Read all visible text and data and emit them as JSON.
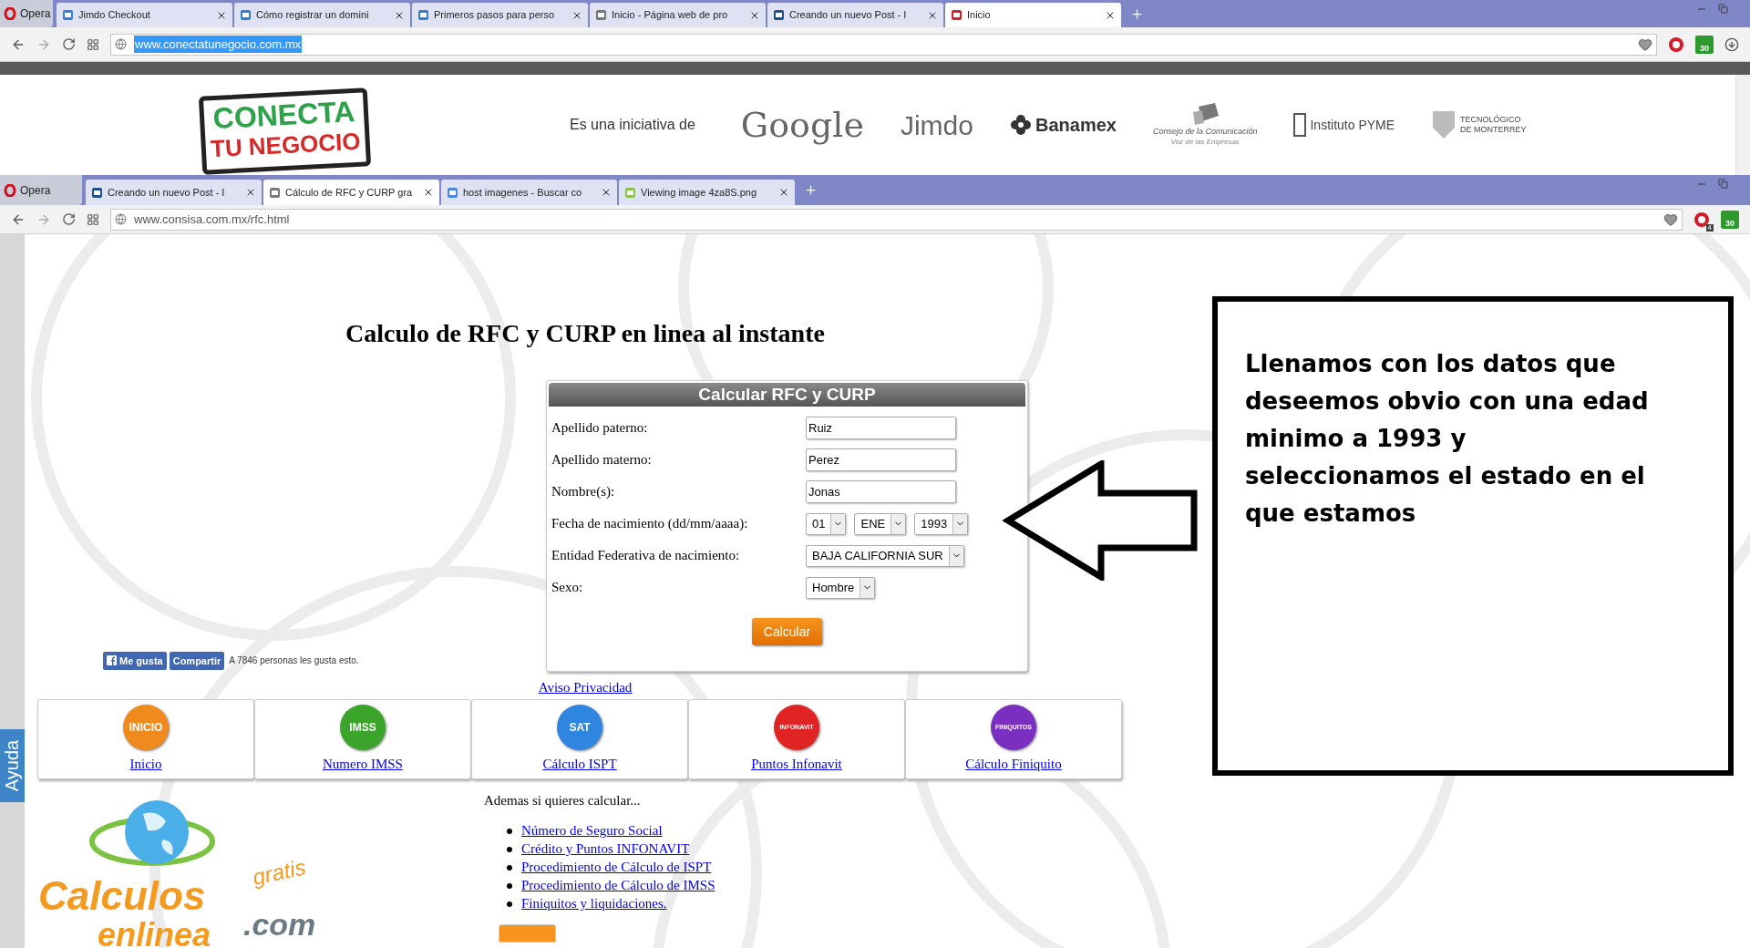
{
  "back_window": {
    "menu_button": "Opera",
    "tabs": [
      {
        "label": "Jimdo Checkout",
        "selected": false,
        "color": "#2f7fd6"
      },
      {
        "label": "Cómo registrar un domini",
        "selected": false,
        "color": "#2f7fd6"
      },
      {
        "label": "Primeros pasos para perso",
        "selected": false,
        "color": "#2f7fd6"
      },
      {
        "label": "Inicio - Página web de pro",
        "selected": false,
        "color": "#777777"
      },
      {
        "label": "Creando un nuevo Post - I",
        "selected": false,
        "color": "#1d4f8c"
      },
      {
        "label": "Inicio",
        "selected": true,
        "color": "#d81e2c"
      }
    ],
    "address": {
      "value": "www.conectatunegocio.com.mx",
      "highlighted": true
    },
    "extension_badge": "30",
    "header": {
      "logo": [
        "CONECTA",
        "TU NEGOCIO"
      ],
      "tagline": "Es una iniciativa de",
      "partners": [
        {
          "kind": "google",
          "name": "Google"
        },
        {
          "kind": "jimdo",
          "name": "Jimdo"
        },
        {
          "kind": "banamex",
          "name": "Banamex"
        },
        {
          "kind": "consejo",
          "name": "Consejo de la Comunicación",
          "sub": "Voz de las Empresas"
        },
        {
          "kind": "pyme",
          "name": "Instituto PYME"
        },
        {
          "kind": "tec",
          "name": "TECNOLÓGICO DE MONTERREY"
        }
      ]
    }
  },
  "front_window": {
    "menu_button": "Opera",
    "tabs": [
      {
        "label": "Creando un nuevo Post - I",
        "selected": false,
        "color": "#1d4f8c"
      },
      {
        "label": "Cálculo de RFC y CURP gra",
        "selected": true,
        "color": "#777777"
      },
      {
        "label": "host imagenes - Buscar co",
        "selected": false,
        "color": "#4a86e8"
      },
      {
        "label": "Viewing image 4za8S.png",
        "selected": false,
        "color": "#8bc34a"
      }
    ],
    "address": {
      "value": "www.consisa.com.mx/rfc.html",
      "highlighted": false
    },
    "notification_badge": "4",
    "extension_badge": "30"
  },
  "page": {
    "title": "Calculo de RFC y CURP en linea al instante",
    "form": {
      "title": "Calcular RFC y CURP",
      "fields": [
        {
          "kind": "text",
          "label": "Apellido paterno:",
          "value": "Ruiz"
        },
        {
          "kind": "text",
          "label": "Apellido materno:",
          "value": "Perez"
        },
        {
          "kind": "text",
          "label": "Nombre(s):",
          "value": "Jonas"
        },
        {
          "kind": "select",
          "label": "Fecha de nacimiento (dd/mm/aaaa):",
          "options": [
            "01",
            "ENE",
            "1993"
          ]
        },
        {
          "kind": "select",
          "label": "Entidad Federativa de nacimiento:",
          "options": [
            "BAJA CALIFORNIA SUR"
          ]
        },
        {
          "kind": "select",
          "label": "Sexo:",
          "options": [
            "Hombre"
          ]
        }
      ],
      "button": "Calcular"
    },
    "social": {
      "like": "Me gusta",
      "share": "Compartir",
      "count": "A 7846 personas les gusta esto."
    },
    "privacy_link": "Aviso Privacidad",
    "cards": [
      {
        "badge": "INICIO",
        "label": "Inicio",
        "color": "#f08a1c"
      },
      {
        "badge": "IMSS",
        "label": "Numero IMSS",
        "color": "#3aa52a"
      },
      {
        "badge": "SAT",
        "label": "Cálculo ISPT",
        "color": "#2f86e0"
      },
      {
        "badge": "INFONAVIT",
        "label": "Puntos Infonavit",
        "color": "#e02424"
      },
      {
        "badge": "FINIQUITOS",
        "label": "Cálculo Finiquito",
        "color": "#7b2fc0"
      }
    ],
    "more": {
      "intro": "Ademas si quieres calcular...",
      "links": [
        "Número de Seguro Social",
        "Crédito y Puntos INFONAVIT",
        "Procedimiento de Cálculo de ISPT",
        "Procedimiento de Cálculo de IMSS",
        "Finiquitos y liquidaciones."
      ]
    },
    "site_logo": {
      "name": "Calculos",
      "name2": "enlinea",
      "domain": ".com",
      "tag": "gratis"
    },
    "help_tab": "Ayuda"
  },
  "annotation": {
    "text": "Llenamos con los datos que deseemos obvio con una edad minimo a 1993 y seleccionamos el estado en el que estamos"
  }
}
